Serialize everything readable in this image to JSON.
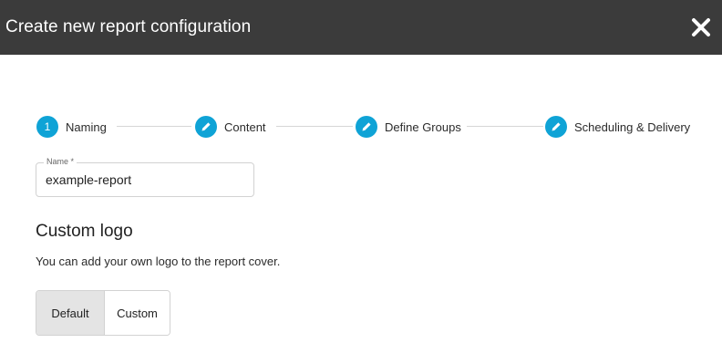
{
  "dialog": {
    "title": "Create new report configuration",
    "close_icon": "close-icon"
  },
  "stepper": {
    "steps": [
      {
        "label": "Naming",
        "marker": "1",
        "icon": "number"
      },
      {
        "label": "Content",
        "icon": "pencil-icon"
      },
      {
        "label": "Define Groups",
        "icon": "pencil-icon"
      },
      {
        "label": "Scheduling & Delivery",
        "icon": "pencil-icon"
      }
    ],
    "accent_color": "#0fa3d6"
  },
  "name_field": {
    "label": "Name *",
    "value": "example-report"
  },
  "custom_logo": {
    "title": "Custom logo",
    "description": "You can add your own logo to the report cover.",
    "options": [
      "Default",
      "Custom"
    ],
    "selected": "Default"
  }
}
